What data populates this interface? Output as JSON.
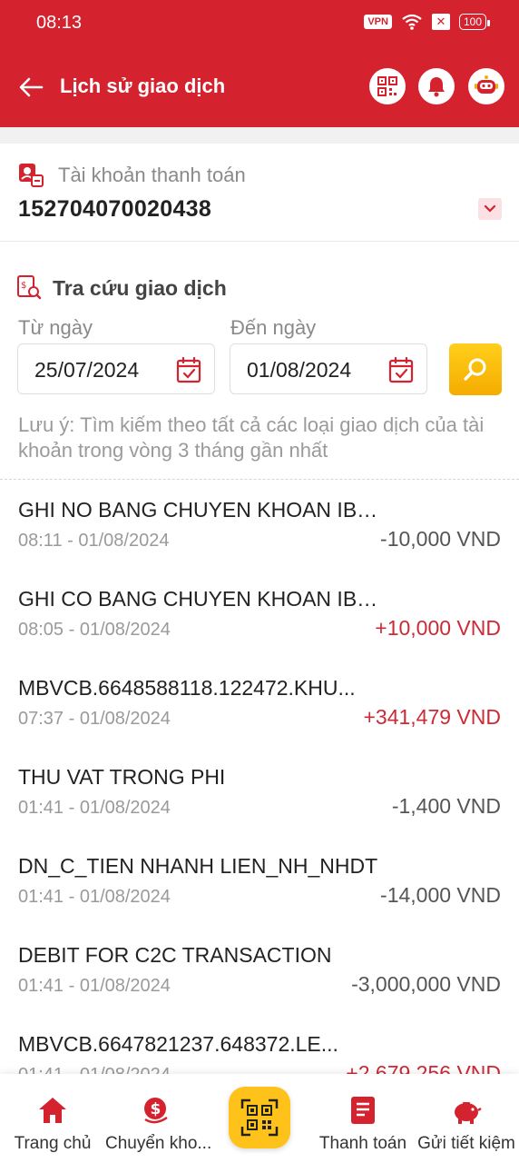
{
  "status_bar": {
    "time": "08:13",
    "vpn": "VPN",
    "battery": "100"
  },
  "header": {
    "title": "Lịch sử giao dịch"
  },
  "account": {
    "label": "Tài khoản thanh toán",
    "number": "152704070020438"
  },
  "search": {
    "title": "Tra cứu giao dịch",
    "from_label": "Từ ngày",
    "to_label": "Đến ngày",
    "from_date": "25/07/2024",
    "to_date": "01/08/2024",
    "note": "Lưu ý: Tìm kiếm theo tất cả các loại giao dịch của tài khoản trong vòng 3 tháng gần nhất"
  },
  "transactions": [
    {
      "desc": "GHI NO BANG CHUYEN KHOAN IBA...",
      "time": "08:11 - 01/08/2024",
      "amount": "-10,000 VND",
      "sign": "neg"
    },
    {
      "desc": "GHI CO BANG CHUYEN KHOAN IBA...",
      "time": "08:05 - 01/08/2024",
      "amount": "+10,000 VND",
      "sign": "pos"
    },
    {
      "desc": "MBVCB.6648588118.122472.KHU...",
      "time": "07:37 - 01/08/2024",
      "amount": "+341,479 VND",
      "sign": "pos"
    },
    {
      "desc": "THU VAT TRONG PHI",
      "time": "01:41 - 01/08/2024",
      "amount": "-1,400 VND",
      "sign": "neg"
    },
    {
      "desc": "DN_C_TIEN NHANH LIEN_NH_NHDT",
      "time": "01:41 - 01/08/2024",
      "amount": "-14,000 VND",
      "sign": "neg"
    },
    {
      "desc": "DEBIT FOR C2C TRANSACTION",
      "time": "01:41 - 01/08/2024",
      "amount": "-3,000,000 VND",
      "sign": "neg"
    },
    {
      "desc": "MBVCB.6647821237.648372.LE...",
      "time": "01:41 - 01/08/2024",
      "amount": "+2,679,256 VND",
      "sign": "pos"
    }
  ],
  "bottom_nav": {
    "home": "Trang chủ",
    "transfer": "Chuyển kho...",
    "payment": "Thanh toán",
    "savings": "Gửi tiết kiệm"
  },
  "colors": {
    "brand_red": "#d4232f",
    "accent_yellow": "#ffc21a",
    "positive": "#cc2a36"
  }
}
